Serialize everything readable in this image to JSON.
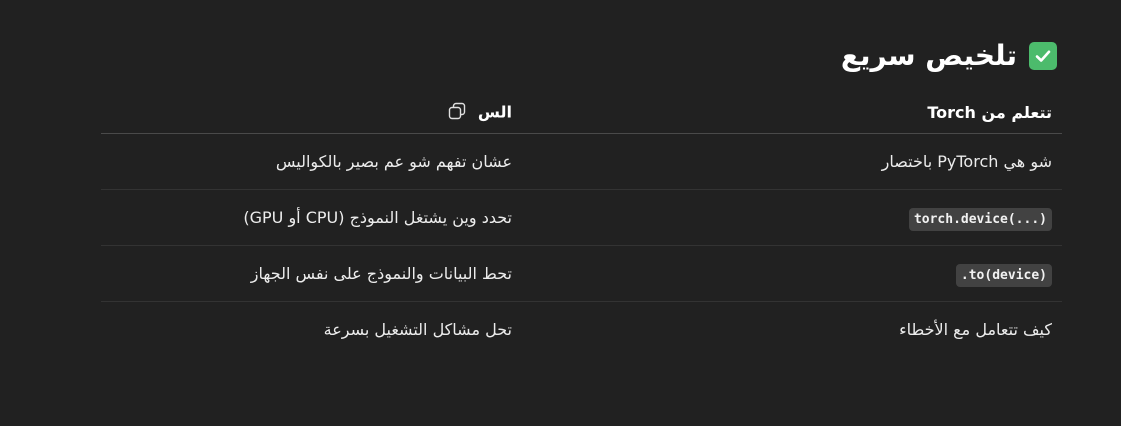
{
  "heading": {
    "title": "تلخيص سريع",
    "icon": "check-mark-button-icon",
    "icon_color": "#4cbb6c"
  },
  "table": {
    "headers": [
      "تتعلم من Torch",
      "الس"
    ],
    "rows": [
      {
        "right": "شو هي PyTorch باختصار",
        "left": "عشان تفهم شو عم بصير بالكواليس",
        "right_is_code": false
      },
      {
        "right": "torch.device(...)",
        "left": "تحدد وين يشتغل النموذج (CPU أو GPU)",
        "right_is_code": true
      },
      {
        "right": ".to(device)",
        "left": "تحط البيانات والنموذج على نفس الجهاز",
        "right_is_code": true
      },
      {
        "right": "كيف تتعامل مع الأخطاء",
        "left": "تحل مشاكل التشغيل بسرعة",
        "right_is_code": false
      }
    ]
  },
  "colors": {
    "background": "#212121",
    "code_background": "#424242"
  }
}
